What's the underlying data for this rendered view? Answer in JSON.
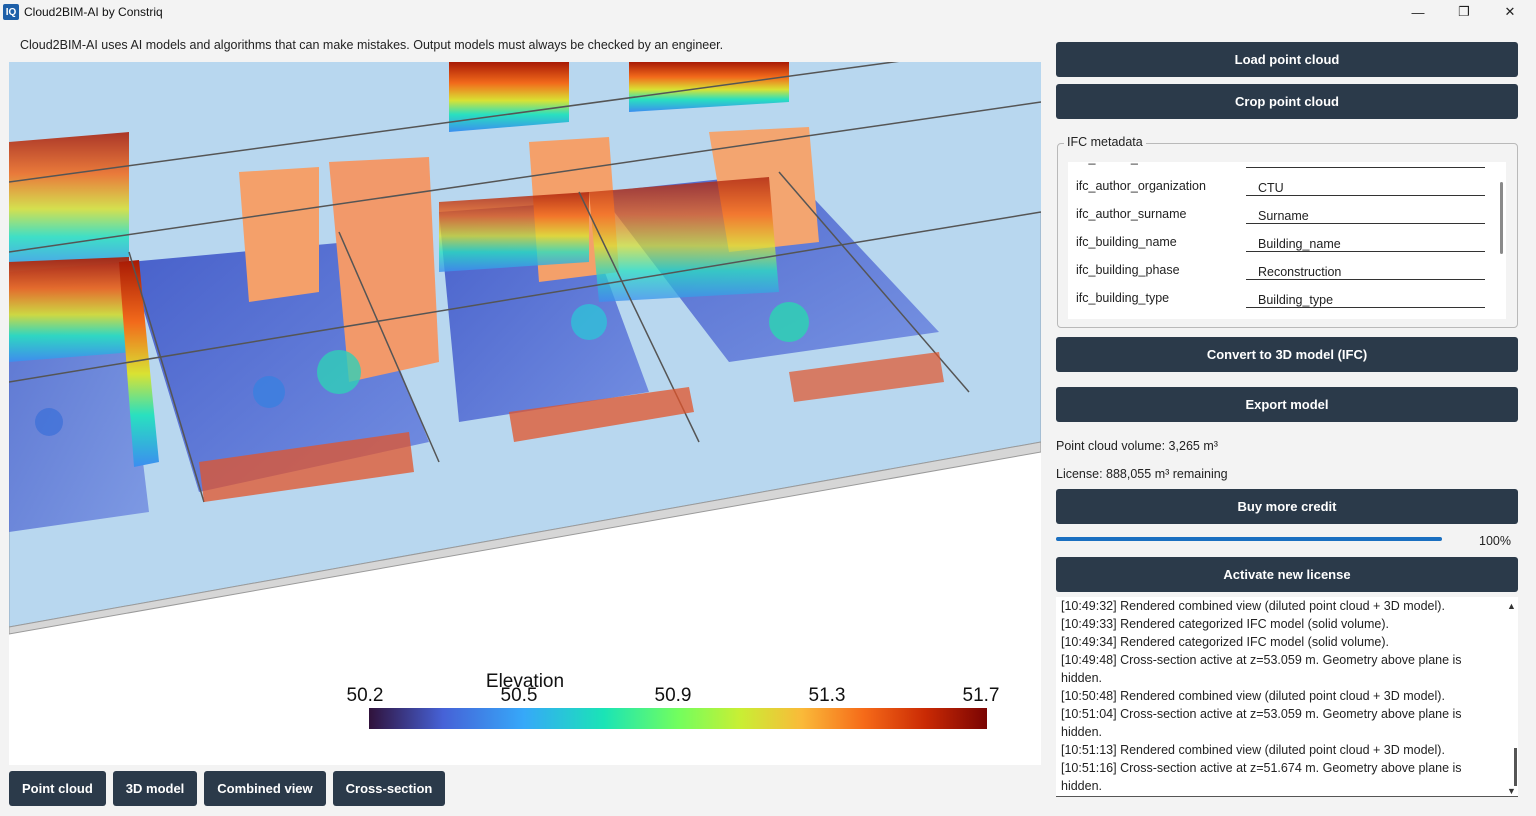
{
  "window": {
    "title": "Cloud2BIM-AI by Constriq",
    "icon_text": "IQ",
    "controls": {
      "minimize": "—",
      "maximize": "❐",
      "close": "✕"
    }
  },
  "disclaimer": "Cloud2BIM-AI uses AI models and algorithms that can make mistakes. Output models must always be checked by an engineer.",
  "viewport": {
    "colorbar": {
      "title": "Elevation",
      "ticks": [
        "50.2",
        "50.5",
        "50.9",
        "51.3",
        "51.7"
      ],
      "colors": [
        "#30123b",
        "#4662d7",
        "#36a8f9",
        "#1ae4b6",
        "#72fe5e",
        "#c8ef34",
        "#faba39",
        "#f66b19",
        "#ca2a04",
        "#7a0403"
      ]
    }
  },
  "view_tabs": [
    {
      "label": "Point cloud"
    },
    {
      "label": "3D model"
    },
    {
      "label": "Combined view"
    },
    {
      "label": "Cross-section"
    }
  ],
  "actions": {
    "load": "Load point cloud",
    "crop": "Crop point cloud",
    "convert": "Convert to 3D model (IFC)",
    "export": "Export model",
    "buy": "Buy more credit",
    "activate": "Activate new license"
  },
  "ifc_metadata": {
    "title": "IFC metadata",
    "rows": [
      {
        "key": "ifc_author_name",
        "value": ""
      },
      {
        "key": "ifc_author_organization",
        "value": "CTU"
      },
      {
        "key": "ifc_author_surname",
        "value": "Surname"
      },
      {
        "key": "ifc_building_name",
        "value": "Building_name"
      },
      {
        "key": "ifc_building_phase",
        "value": "Reconstruction"
      },
      {
        "key": "ifc_building_type",
        "value": "Building_type"
      }
    ]
  },
  "status": {
    "volume": "Point cloud volume: 3,265 m³",
    "license": "License: 888,055 m³ remaining",
    "progress_value": 100,
    "progress_text": "100%"
  },
  "log": [
    "[10:49:32] Rendered combined view (diluted point cloud + 3D model).",
    "[10:49:33] Rendered categorized IFC model (solid volume).",
    "[10:49:34] Rendered categorized IFC model (solid volume).",
    "[10:49:48] Cross-section active at z=53.059 m. Geometry above plane is hidden.",
    "[10:50:48] Rendered combined view (diluted point cloud + 3D model).",
    "[10:51:04] Cross-section active at z=53.059 m. Geometry above plane is hidden.",
    "[10:51:13] Rendered combined view (diluted point cloud + 3D model).",
    "[10:51:16] Cross-section active at z=51.674 m. Geometry above plane is hidden."
  ]
}
